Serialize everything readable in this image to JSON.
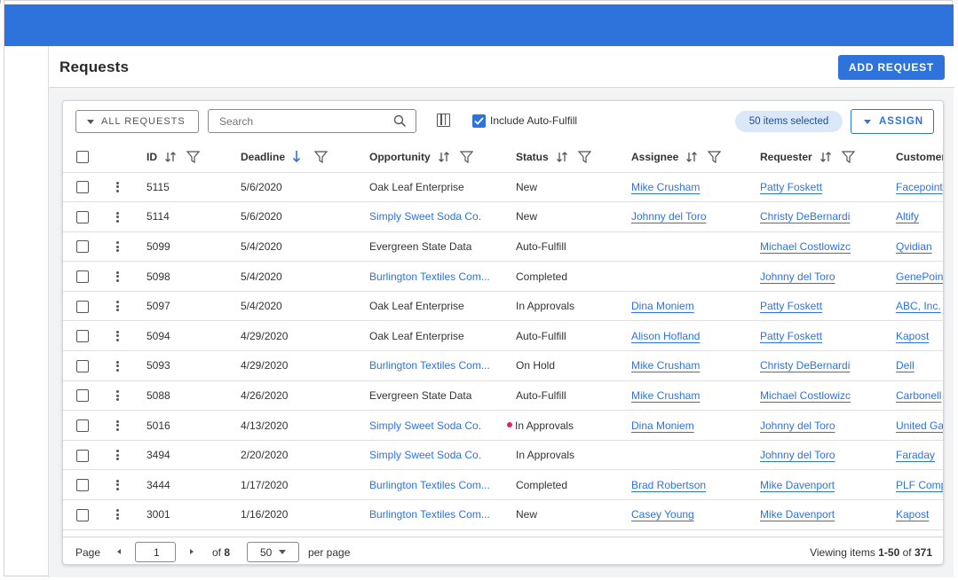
{
  "header": {
    "title": "Requests",
    "add_button": "ADD REQUEST"
  },
  "toolbar": {
    "filter_label": "ALL REQUESTS",
    "search_placeholder": "Search",
    "auto_fulfill_label": "Include Auto-Fulfill",
    "auto_fulfill_checked": true,
    "selected_text": "50 items selected",
    "assign_label": "ASSIGN"
  },
  "columns": [
    "ID",
    "Deadline",
    "Opportunity",
    "Status",
    "Assignee",
    "Requester",
    "Customer"
  ],
  "rows": [
    {
      "id": "5115",
      "deadline": "5/6/2020",
      "opportunity": "Oak Leaf Enterprise",
      "opp_link": false,
      "status": "New",
      "flag": false,
      "assignee": "Mike Crusham",
      "requester": "Patty Foskett",
      "customer": "Facepoint"
    },
    {
      "id": "5114",
      "deadline": "5/6/2020",
      "opportunity": "Simply Sweet Soda Co.",
      "opp_link": true,
      "status": "New",
      "flag": false,
      "assignee": "Johnny del Toro",
      "requester": "Christy DeBernardi",
      "customer": "Altify"
    },
    {
      "id": "5099",
      "deadline": "5/4/2020",
      "opportunity": "Evergreen State Data",
      "opp_link": false,
      "status": "Auto-Fulfill",
      "flag": false,
      "assignee": "",
      "requester": "Michael Costlowizc",
      "customer": "Qvidian"
    },
    {
      "id": "5098",
      "deadline": "5/4/2020",
      "opportunity": "Burlington Textiles Com...",
      "opp_link": true,
      "status": "Completed",
      "flag": false,
      "assignee": "",
      "requester": "Johnny del Toro",
      "customer": "GenePoint"
    },
    {
      "id": "5097",
      "deadline": "5/4/2020",
      "opportunity": "Oak Leaf Enterprise",
      "opp_link": false,
      "status": "In Approvals",
      "flag": false,
      "assignee": "Dina Moniem",
      "requester": "Patty Foskett",
      "customer": "ABC, Inc."
    },
    {
      "id": "5094",
      "deadline": "4/29/2020",
      "opportunity": "Oak Leaf Enterprise",
      "opp_link": false,
      "status": "Auto-Fulfill",
      "flag": false,
      "assignee": "Alison Hofland",
      "requester": "Patty Foskett",
      "customer": "Kapost"
    },
    {
      "id": "5093",
      "deadline": "4/29/2020",
      "opportunity": "Burlington Textiles Com...",
      "opp_link": true,
      "status": "On Hold",
      "flag": false,
      "assignee": "Mike Crusham",
      "requester": "Christy DeBernardi",
      "customer": "Dell"
    },
    {
      "id": "5088",
      "deadline": "4/26/2020",
      "opportunity": "Evergreen State Data",
      "opp_link": false,
      "status": "Auto-Fulfill",
      "flag": false,
      "assignee": "Mike Crusham",
      "requester": "Michael Costlowizc",
      "customer": "Carbonell"
    },
    {
      "id": "5016",
      "deadline": "4/13/2020",
      "opportunity": "Simply Sweet Soda Co.",
      "opp_link": true,
      "status": "In Approvals",
      "flag": true,
      "assignee": "Dina Moniem",
      "requester": "Johnny del Toro",
      "customer": "United Ga"
    },
    {
      "id": "3494",
      "deadline": "2/20/2020",
      "opportunity": "Simply Sweet Soda Co.",
      "opp_link": true,
      "status": "In Approvals",
      "flag": false,
      "assignee": "",
      "requester": "Johnny del Toro",
      "customer": "Faraday"
    },
    {
      "id": "3444",
      "deadline": "1/17/2020",
      "opportunity": "Burlington Textiles Com...",
      "opp_link": true,
      "status": "Completed",
      "flag": false,
      "assignee": "Brad Robertson",
      "requester": "Mike Davenport",
      "customer": "PLF Comp"
    },
    {
      "id": "3001",
      "deadline": "1/16/2020",
      "opportunity": "Burlington Textiles Com...",
      "opp_link": true,
      "status": "New",
      "flag": false,
      "assignee": "Casey Young",
      "requester": "Mike Davenport",
      "customer": "Kapost"
    }
  ],
  "footer": {
    "page_label": "Page",
    "page_value": "1",
    "of_label": "of",
    "total_pages": "8",
    "per_page_value": "50",
    "per_page_label": "per page",
    "viewing_prefix": "Viewing items ",
    "viewing_range": "1-50",
    "viewing_of": " of ",
    "viewing_total": "371"
  },
  "colors": {
    "primary": "#2e73dc",
    "flag": "#e0245e",
    "pill_bg": "#dbe8fa"
  }
}
